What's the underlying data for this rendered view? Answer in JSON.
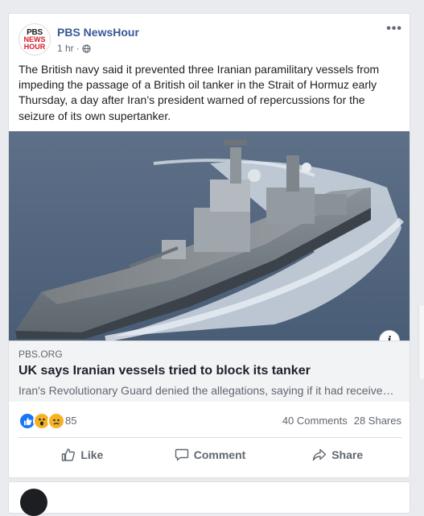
{
  "post": {
    "page_name": "PBS NewsHour",
    "avatar": {
      "line1": "PBS",
      "line2": "NEWS",
      "line3": "HOUR"
    },
    "time": "1 hr",
    "separator": "·",
    "privacy_icon": "globe-icon",
    "more_icon": "•••",
    "text": "The British navy said it prevented three Iranian paramilitary vessels from impeding the passage of a British oil tanker in the Strait of Hormuz early Thursday, a day after Iran’s president warned of repercussions for the seizure of its own supertanker.",
    "info_icon": "i"
  },
  "link": {
    "domain": "PBS.ORG",
    "title": "UK says Iranian vessels tried to block its tanker",
    "description": "Iran's Revolutionary Guard denied the allegations, saying if it had received any orders to seize ships, it would have done so immediately."
  },
  "reactions": {
    "types": [
      "like",
      "wow",
      "sad"
    ],
    "count": "85",
    "comments": "40 Comments",
    "shares": "28 Shares"
  },
  "actions": {
    "like": "Like",
    "comment": "Comment",
    "share": "Share"
  },
  "colors": {
    "page_name": "#385898",
    "like_blue": "#1877f2",
    "reaction_yellow": "#f7b125",
    "background": "#e9ebee"
  }
}
